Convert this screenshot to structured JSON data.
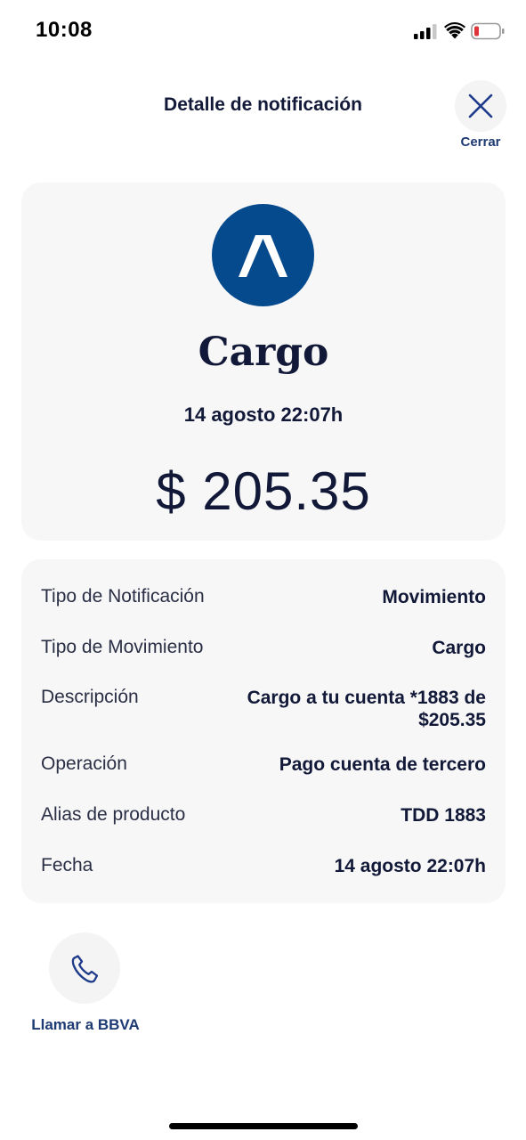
{
  "status_bar": {
    "time": "10:08"
  },
  "header": {
    "title": "Detalle de notificación",
    "close_label": "Cerrar"
  },
  "summary": {
    "icon": "arrow-up-caret-icon",
    "title": "Cargo",
    "date": "14 agosto 22:07h",
    "amount": "$ 205.35"
  },
  "details": {
    "rows": [
      {
        "label": "Tipo de Notificación",
        "value": "Movimiento"
      },
      {
        "label": "Tipo de Movimiento",
        "value": "Cargo"
      },
      {
        "label": "Descripción",
        "value": "Cargo a tu cuenta *1883 de $205.35"
      },
      {
        "label": "Operación",
        "value": "Pago cuenta de tercero"
      },
      {
        "label": "Alias de producto",
        "value": "TDD 1883"
      },
      {
        "label": "Fecha",
        "value": "14 agosto 22:07h"
      }
    ]
  },
  "actions": {
    "call_label": "Llamar a BBVA"
  },
  "colors": {
    "brand_blue": "#064a8e",
    "text_navy": "#121938",
    "link_blue": "#1e3a73",
    "card_bg": "#f7f7f7",
    "battery_low": "#e0343b"
  }
}
